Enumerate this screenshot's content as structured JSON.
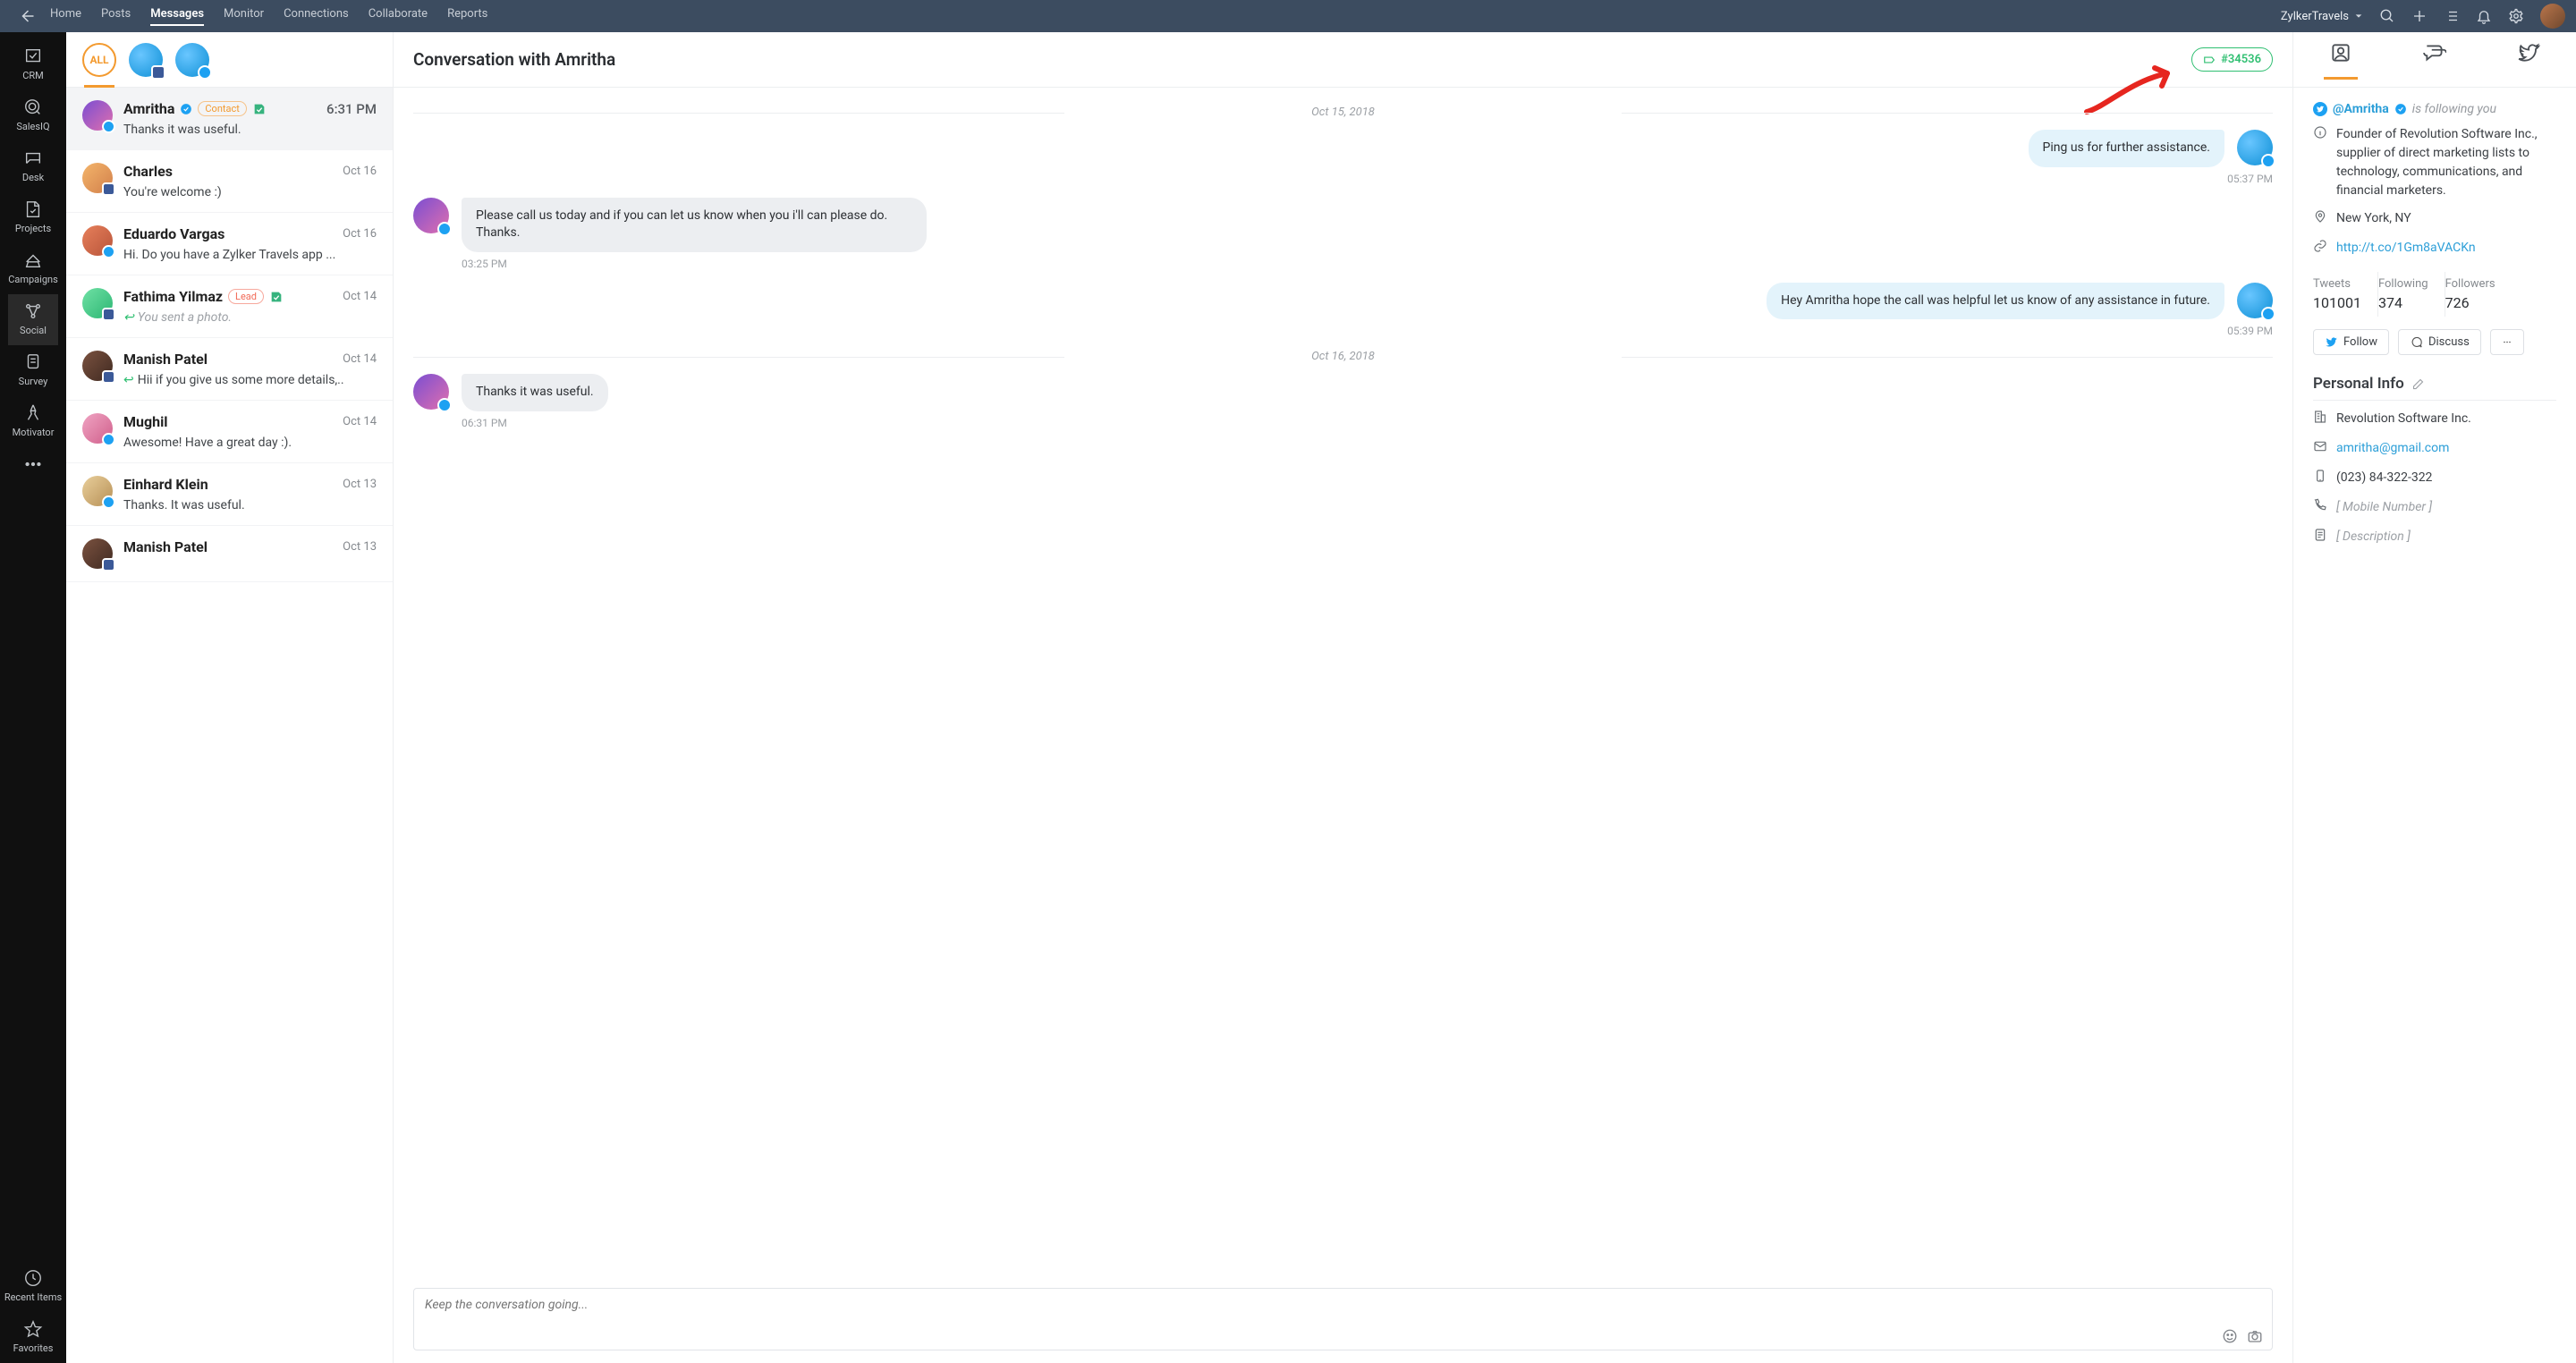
{
  "topnav": [
    "Home",
    "Posts",
    "Messages",
    "Monitor",
    "Connections",
    "Collaborate",
    "Reports"
  ],
  "topnav_active": 2,
  "brand_name": "ZylkerTravels",
  "rail": [
    {
      "label": "CRM"
    },
    {
      "label": "SalesIQ"
    },
    {
      "label": "Desk"
    },
    {
      "label": "Projects"
    },
    {
      "label": "Campaigns"
    },
    {
      "label": "Social"
    },
    {
      "label": "Survey"
    },
    {
      "label": "Motivator"
    }
  ],
  "rail_recent": "Recent Items",
  "rail_fav": "Favorites",
  "all_label": "ALL",
  "conversations": [
    {
      "name": "Amritha",
      "net": "tw",
      "badge": "Contact",
      "crm": true,
      "verified": true,
      "time": "6:31 PM",
      "time_big": true,
      "snippet": "Thanks it was useful.",
      "selected": true,
      "av": "av-grad1"
    },
    {
      "name": "Charles",
      "net": "fb",
      "time": "Oct 16",
      "snippet": "You're welcome :)",
      "av": "av-grad2"
    },
    {
      "name": "Eduardo Vargas",
      "net": "tw",
      "time": "Oct 16",
      "snippet": "Hi. Do you have a Zylker Travels app ...",
      "av": "av-grad3"
    },
    {
      "name": "Fathima Yilmaz",
      "net": "fb",
      "badge": "Lead",
      "crm": true,
      "time": "Oct 14",
      "snippet": "You sent a photo.",
      "sent": true,
      "reply": true,
      "av": "av-grad4"
    },
    {
      "name": "Manish Patel",
      "net": "fb",
      "time": "Oct 14",
      "snippet": "Hii if you give us some more details,..",
      "reply": true,
      "av": "av-grad5"
    },
    {
      "name": "Mughil",
      "net": "tw",
      "time": "Oct 14",
      "snippet": "Awesome! Have a great day :).",
      "av": "av-grad6"
    },
    {
      "name": "Einhard Klein",
      "net": "tw",
      "time": "Oct 13",
      "snippet": "Thanks. It was useful.",
      "av": "av-grad7"
    },
    {
      "name": "Manish Patel",
      "net": "fb",
      "time": "Oct 13",
      "snippet": "",
      "av": "av-grad5"
    }
  ],
  "thread": {
    "title": "Conversation with Amritha",
    "ticket": "#34536",
    "dates": [
      "Oct 15, 2018",
      "Oct 16, 2018"
    ],
    "m1": {
      "text": "Ping us for further assistance.",
      "time": "05:37 PM"
    },
    "m2": {
      "text": "Please call us today and if you can let us know when you i'll can please do. Thanks.",
      "time": "03:25 PM"
    },
    "m3": {
      "text": "Hey Amritha hope the call was helpful let us know of any assistance in future.",
      "time": "05:39 PM"
    },
    "m4": {
      "text": "Thanks it was useful.",
      "time": "06:31 PM"
    },
    "composer_placeholder": "Keep the conversation going..."
  },
  "info": {
    "handle": "@Amritha",
    "following_text": "is following you",
    "bio": "Founder of Revolution Software Inc., supplier of direct marketing lists to technology, communications, and financial marketers.",
    "location": "New York, NY",
    "url": "http://t.co/1Gm8aVACKn",
    "stats": {
      "tweets_label": "Tweets",
      "tweets": "101001",
      "following_label": "Following",
      "following": "374",
      "followers_label": "Followers",
      "followers": "726"
    },
    "btn_follow": "Follow",
    "btn_discuss": "Discuss",
    "section_personal": "Personal Info",
    "company": "Revolution Software Inc.",
    "email": "amritha@gmail.com",
    "phone": "(023) 84-322-322",
    "mobile_ph": "[ Mobile Number ]",
    "desc_ph": "[ Description ]"
  }
}
